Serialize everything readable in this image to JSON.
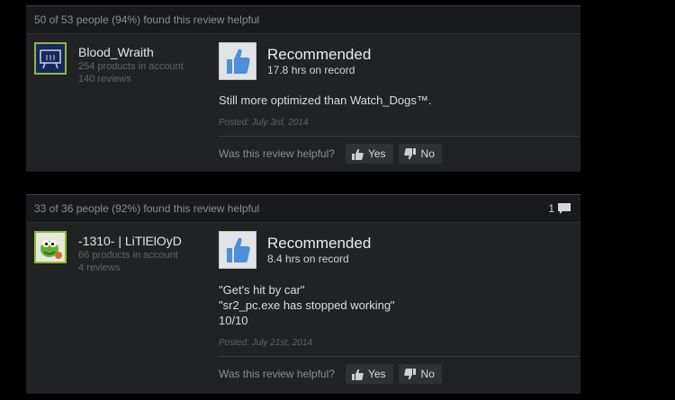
{
  "reviews": [
    {
      "helpful_text": "50 of 53 people (94%) found this review helpful",
      "author": {
        "name": "Blood_Wraith",
        "products": "254 products in account",
        "reviews": "140 reviews",
        "avatar_icon": "presentation-board-icon"
      },
      "verdict": "Recommended",
      "hours": "17.8 hrs on record",
      "text_lines": [
        "Still more optimized than Watch_Dogs™."
      ],
      "posted": "Posted: July 3rd, 2014",
      "helpful_prompt": "Was this review helpful?",
      "yes_label": "Yes",
      "no_label": "No"
    },
    {
      "helpful_text": "33 of 36 people (92%) found this review helpful",
      "comment_count": "1",
      "author": {
        "name": "-1310- | LiTlElOyD",
        "products": "66 products in account",
        "reviews": "4 reviews",
        "avatar_icon": "green-cartoon-character-icon"
      },
      "verdict": "Recommended",
      "hours": "8.4 hrs on record",
      "text_lines": [
        "\"Get's hit by car\"",
        "\"sr2_pc.exe has stopped working\"",
        "10/10"
      ],
      "posted": "Posted: July 21st, 2014",
      "helpful_prompt": "Was this review helpful?",
      "yes_label": "Yes",
      "no_label": "No"
    }
  ],
  "colors": {
    "panel_bg": "#202224",
    "header_bg": "#191a1c",
    "thumb_blue": "#4c8fd6",
    "avatar_border": "#8fb93b"
  }
}
